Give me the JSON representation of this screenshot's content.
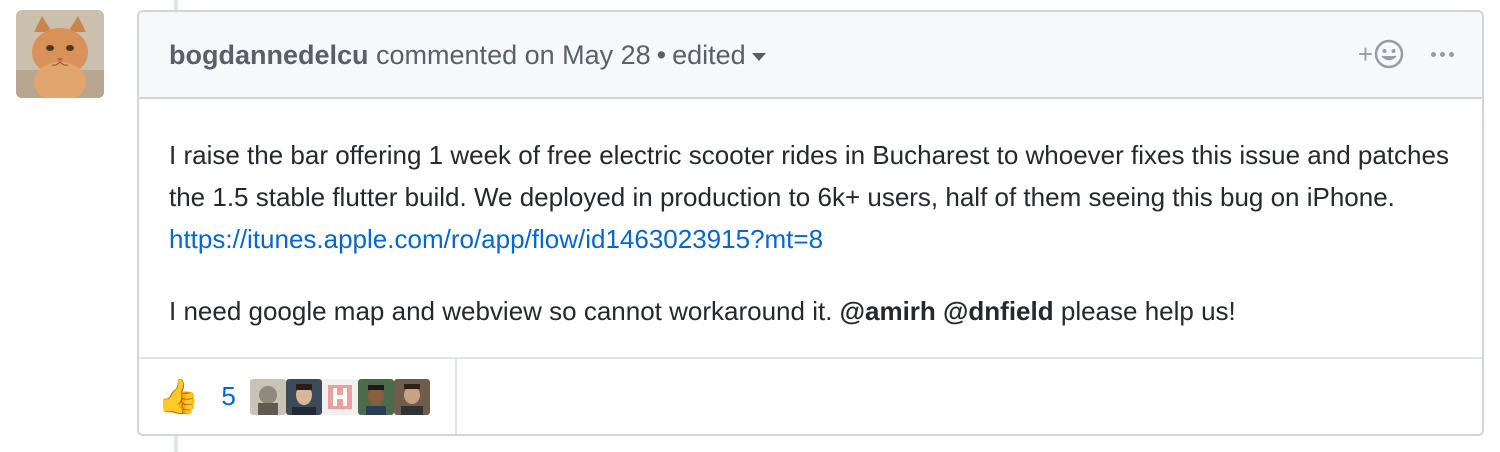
{
  "comment": {
    "author": "bogdannedelcu",
    "action_text": "commented on May 28",
    "separator": "•",
    "edited_label": "edited",
    "body": {
      "p1_text": "I raise the bar offering 1 week of free electric scooter rides in Bucharest to whoever fixes this issue and patches the 1.5 stable flutter build. We deployed in production to 6k+ users, half of them seeing this bug on iPhone.",
      "p1_link": "https://itunes.apple.com/ro/app/flow/id1463023915?mt=8",
      "p2_text": "I need google map and webview so cannot workaround it.",
      "mention1": "@amirh",
      "mention2": "@dnfield",
      "p2_tail": "please help us!"
    },
    "add_reaction_label": "+",
    "reactions": [
      {
        "emoji": "👍",
        "icon": "thumbs-up-icon",
        "count": "5"
      }
    ]
  }
}
